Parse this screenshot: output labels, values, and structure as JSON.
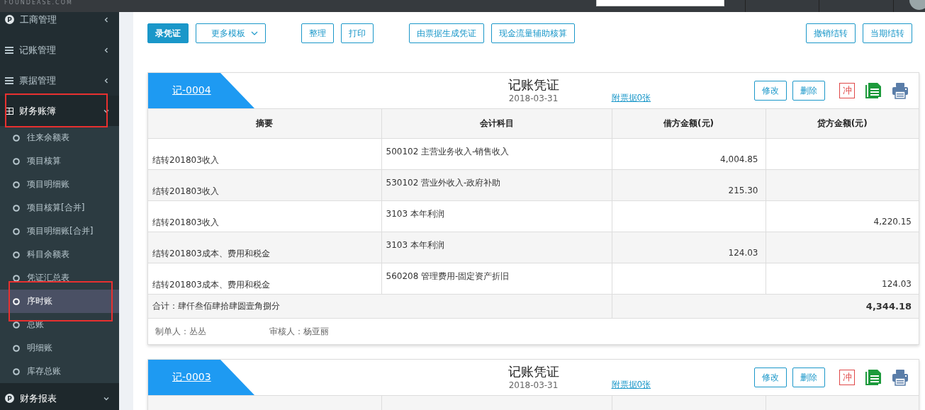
{
  "top_bar": {
    "logo": "FOUNDEASE.COM"
  },
  "sidebar": {
    "groups": [
      {
        "label": "工商管理",
        "kind": "badge",
        "badge": "P",
        "expanded": false,
        "annotated": false
      },
      {
        "label": "记账管理",
        "kind": "list",
        "expanded": false,
        "annotated": false
      },
      {
        "label": "票据管理",
        "kind": "list",
        "expanded": false,
        "annotated": false
      },
      {
        "label": "财务账簿",
        "kind": "grid",
        "expanded": true,
        "annotated": true,
        "children": [
          {
            "label": "往来余额表",
            "selected": false,
            "annotated": false
          },
          {
            "label": "项目核算",
            "selected": false,
            "annotated": false
          },
          {
            "label": "项目明细账",
            "selected": false,
            "annotated": false
          },
          {
            "label": "项目核算[合并]",
            "selected": false,
            "annotated": false
          },
          {
            "label": "项目明细账[合并]",
            "selected": false,
            "annotated": false
          },
          {
            "label": "科目余额表",
            "selected": false,
            "annotated": false
          },
          {
            "label": "凭证汇总表",
            "selected": false,
            "annotated": false
          },
          {
            "label": "序时账",
            "selected": true,
            "annotated": true
          },
          {
            "label": "总账",
            "selected": false,
            "annotated": false
          },
          {
            "label": "明细账",
            "selected": false,
            "annotated": false
          },
          {
            "label": "库存总账",
            "selected": false,
            "annotated": false
          }
        ]
      },
      {
        "label": "财务报表",
        "kind": "badge",
        "badge": "P",
        "expanded": true,
        "annotated": false
      }
    ]
  },
  "toolbar": {
    "button_groups": [
      {
        "buttons": [
          {
            "label": "录凭证",
            "kind": "primary"
          },
          {
            "label": "更多模板",
            "kind": "dropdown"
          }
        ]
      },
      {
        "buttons": [
          {
            "label": "整理",
            "kind": "outline"
          },
          {
            "label": "打印",
            "kind": "outline"
          }
        ]
      },
      {
        "buttons": [
          {
            "label": "由票据生成凭证",
            "kind": "outline"
          },
          {
            "label": "现金流量辅助核算",
            "kind": "outline"
          }
        ]
      }
    ],
    "right_buttons": [
      {
        "label": "撤销结转",
        "kind": "outline"
      },
      {
        "label": "当期结转",
        "kind": "outline"
      }
    ]
  },
  "vouchers": [
    {
      "number": "记-0004",
      "title": "记账凭证",
      "date": "2018-03-31",
      "attachments": "附票据0张",
      "actions": [
        "修改",
        "删除"
      ],
      "reverse_mark": "冲",
      "columns": [
        "摘要",
        "会计科目",
        "借方金额(元)",
        "贷方金额(元)"
      ],
      "rows": [
        {
          "summary": "结转201803收入",
          "account": "500102 主营业务收入-销售收入",
          "debit": "4,004.85"
        },
        {
          "summary": "结转201803收入",
          "account": "530102 营业外收入-政府补助",
          "debit": "215.30"
        },
        {
          "summary": "结转201803收入",
          "account": "3103 本年利润",
          "credit": "4,220.15"
        },
        {
          "summary": "结转201803成本、费用和税金",
          "account": "3103 本年利润",
          "debit": "124.03"
        },
        {
          "summary": "结转201803成本、费用和税金",
          "account": "560208 管理费用-固定资产折旧",
          "credit": "124.03"
        }
      ],
      "total": {
        "label": "合计：肆仟叁佰肆拾肆圆壹角捌分",
        "amount": "4,344.18"
      },
      "maker": "制单人：丛丛",
      "reviewer": "审核人：杨亚丽"
    },
    {
      "number": "记-0003",
      "title": "记账凭证",
      "date": "2018-03-31",
      "attachments": "附票据0张",
      "actions": [
        "修改",
        "删除"
      ],
      "reverse_mark": "冲"
    }
  ]
}
